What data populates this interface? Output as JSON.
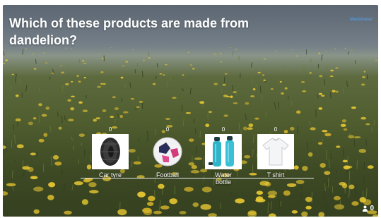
{
  "slide": {
    "question": "Which of these products are made from dandelion?",
    "brand": "Mentimeter"
  },
  "results": {
    "options": [
      {
        "label": "Car tyre",
        "count": "0",
        "image_icon": "car-tyre-icon"
      },
      {
        "label": "Football",
        "count": "0",
        "image_icon": "football-icon"
      },
      {
        "label": "Water bottle",
        "count": "0",
        "image_icon": "water-bottle-icon"
      },
      {
        "label": "T shirt",
        "count": "0",
        "image_icon": "t-shirt-icon"
      }
    ]
  },
  "footer": {
    "participant_count": "0",
    "participant_icon": "person-icon"
  },
  "colors": {
    "brand_link": "#4aa8ff",
    "text": "#ffffff",
    "dandelion_yellow": "#e9c832"
  }
}
